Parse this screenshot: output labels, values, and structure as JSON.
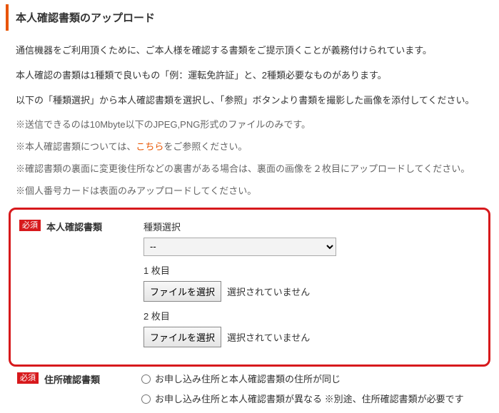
{
  "title": "本人確認書類のアップロード",
  "intro": {
    "p1": "通信機器をご利用頂くために、ご本人様を確認する書類をご提示頂くことが義務付けられています。",
    "p2": "本人確認の書類は1種類で良いもの「例：運転免許証」と、2種類必要なものがあります。",
    "p3": "以下の「種類選択」から本人確認書類を選択し、「参照」ボタンより書類を撮影した画像を添付してください。"
  },
  "notes": {
    "n1": "※送信できるのは10Mbyte以下のJPEG,PNG形式のファイルのみです。",
    "n2_prefix": "※本人確認書類については、",
    "n2_link": "こちら",
    "n2_suffix": "をご参照ください。",
    "n3": "※確認書類の裏面に変更後住所などの裏書がある場合は、裏面の画像を２枚目にアップロードしてください。",
    "n4": "※個人番号カードは表面のみアップロードしてください。"
  },
  "badge_required": "必須",
  "section1": {
    "label": "本人確認書類",
    "type_label": "種類選択",
    "select_value": "--",
    "file1_caption": "1 枚目",
    "file2_caption": "2 枚目",
    "file_button": "ファイルを選択",
    "file_status": "選択されていません"
  },
  "section2": {
    "label": "住所確認書類",
    "radio1": "お申し込み住所と本人確認書類の住所が同じ",
    "radio2": "お申し込み住所と本人確認書類が異なる ※別途、住所確認書類が必要です"
  }
}
